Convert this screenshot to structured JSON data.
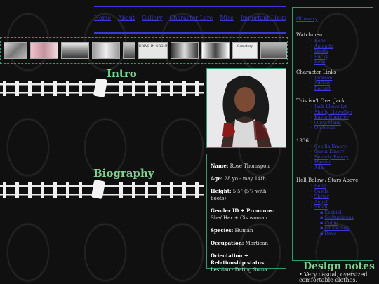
{
  "nav": {
    "links": [
      "Home",
      "About",
      "Gallery",
      "Character Lore",
      "Misc",
      "Important Links"
    ]
  },
  "strip": {
    "labels": [
      "",
      "",
      "",
      "",
      "",
      "DRIVE IN GROUND DIFFERENCE",
      "",
      "Cemetery",
      ""
    ]
  },
  "sections": {
    "intro": "Intro",
    "biography": "Biography"
  },
  "info": {
    "name_label": "Name:",
    "name": "Rose Thomspon",
    "age_label": "Age:",
    "age": "28 yo - may 14th",
    "height_label": "Height:",
    "height": "5'5\" (5'7 with boots)",
    "gender_label": "Gender ID + Pronouns:",
    "gender": "She/ Her + Cis woman",
    "species_label": "Species:",
    "species": "Human",
    "occupation_label": "Occupation:",
    "occupation": "Mortican",
    "orientation_label": "Orientation + Relationship status:",
    "orientation": "Lesbian - Dating Soma"
  },
  "sidebar": {
    "glossary": "Glossary",
    "groups": [
      {
        "title": "Watchmen",
        "items": [
          "Rose",
          "Amanda",
          "Leeds",
          "Rocky",
          "Ross"
        ]
      },
      {
        "title": "Character Links",
        "items": [
          "Jackson",
          "Adrian",
          "Rocket"
        ]
      },
      {
        "title": "This isn't Over Jack",
        "items": [
          "Jack Llewellyn",
          "Shelly Llewellyn",
          "Kayla Guerrier",
          "Olive Mann",
          "Oh Noah"
        ]
      },
      {
        "title": "1936",
        "items": [
          "Cecilia Emery",
          "Gavin Emery",
          "Beverly Emery",
          "Hunter",
          "Ada"
        ]
      },
      {
        "title": "Hell Below / Stars Above",
        "items": [
          "Bebe",
          "Castle",
          "Skyler",
          "Angel",
          "Sloan"
        ],
        "subitems": [
          "Ezekiel",
          "Solitudinous",
          "Collie",
          "Lacewings",
          "Dove"
        ]
      }
    ]
  },
  "design_notes": {
    "title": "Design notes",
    "first": "Very casual, oversized comfortable clothes."
  },
  "colors": {
    "accent": "#7fd38f",
    "border": "#2f9a70",
    "link": "#3a3ad6"
  }
}
